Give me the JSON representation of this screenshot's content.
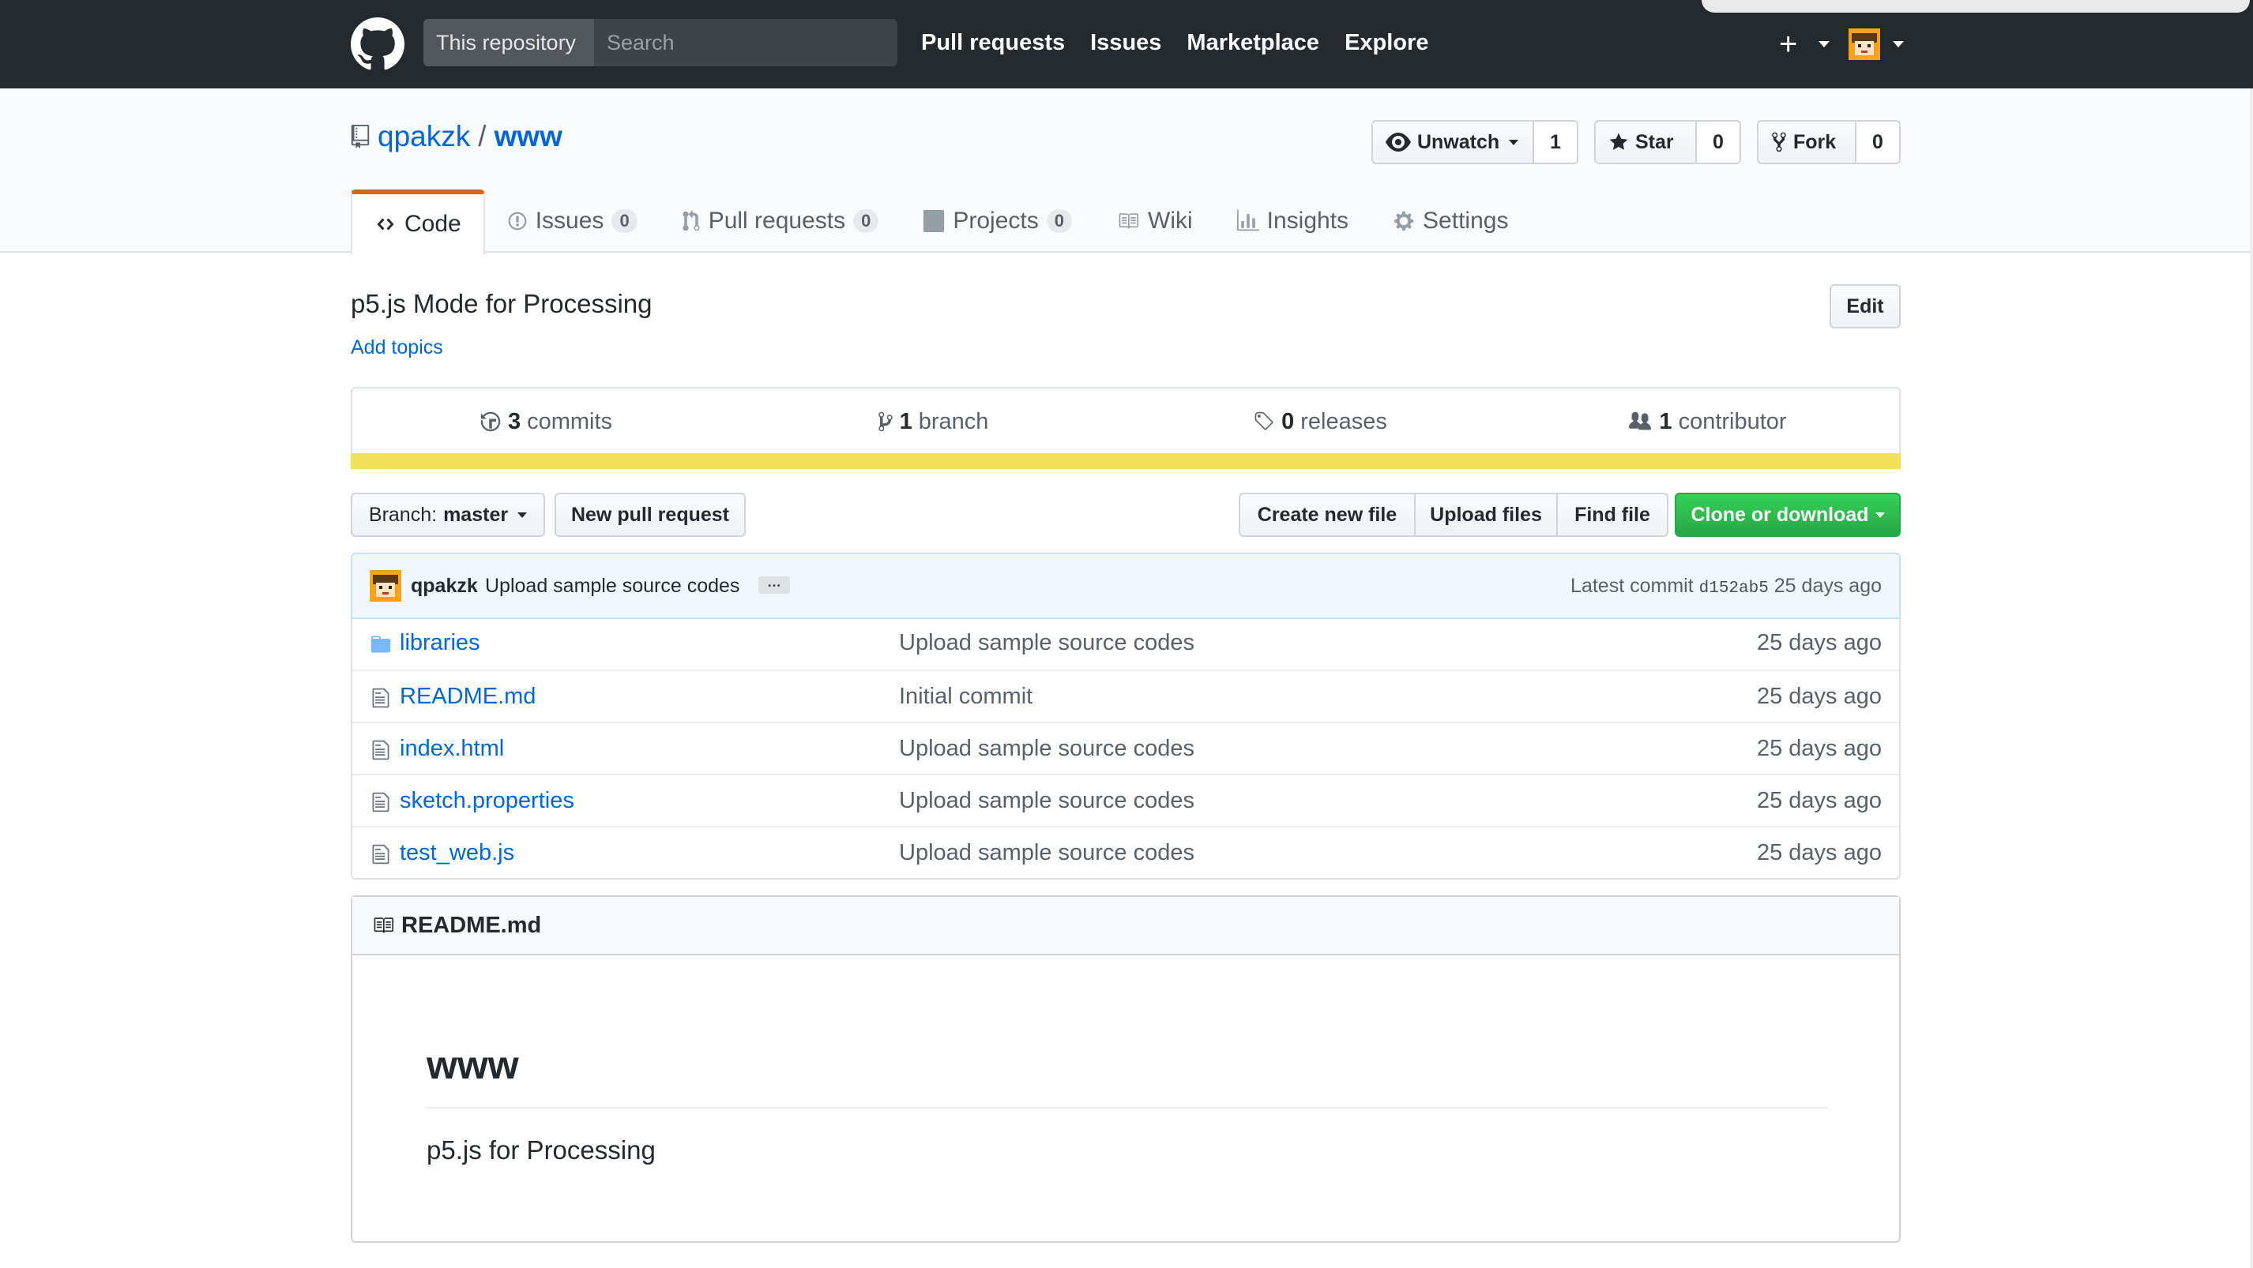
{
  "header": {
    "search_scope": "This repository",
    "search_placeholder": "Search",
    "nav": [
      "Pull requests",
      "Issues",
      "Marketplace",
      "Explore"
    ],
    "plus": "+"
  },
  "repo": {
    "owner": "qpakzk",
    "separator": "/",
    "name": "www",
    "actions": {
      "watch_label": "Unwatch",
      "watch_count": "1",
      "star_label": "Star",
      "star_count": "0",
      "fork_label": "Fork",
      "fork_count": "0"
    },
    "tabs": [
      {
        "label": "Code",
        "counter": ""
      },
      {
        "label": "Issues",
        "counter": "0"
      },
      {
        "label": "Pull requests",
        "counter": "0"
      },
      {
        "label": "Projects",
        "counter": "0"
      },
      {
        "label": "Wiki",
        "counter": ""
      },
      {
        "label": "Insights",
        "counter": ""
      },
      {
        "label": "Settings",
        "counter": ""
      }
    ],
    "description": "p5.js Mode for Processing",
    "add_topics": "Add topics",
    "edit_label": "Edit"
  },
  "summary": {
    "commits_num": "3",
    "commits_label": "commits",
    "branch_num": "1",
    "branch_label": "branch",
    "releases_num": "0",
    "releases_label": "releases",
    "contributor_num": "1",
    "contributor_label": "contributor",
    "language_color": "#f1e05a"
  },
  "file_nav": {
    "branch_prefix": "Branch:",
    "branch_name": "master",
    "new_pr": "New pull request",
    "create_file": "Create new file",
    "upload_files": "Upload files",
    "find_file": "Find file",
    "clone": "Clone or download"
  },
  "commit": {
    "author": "qpakzk",
    "message": "Upload sample source codes",
    "ellipsis": "…",
    "latest_label": "Latest commit",
    "sha": "d152ab5",
    "age": "25 days ago"
  },
  "files": [
    {
      "name": "libraries",
      "type": "folder",
      "message": "Upload sample source codes",
      "age": "25 days ago"
    },
    {
      "name": "README.md",
      "type": "file",
      "message": "Initial commit",
      "age": "25 days ago"
    },
    {
      "name": "index.html",
      "type": "file",
      "message": "Upload sample source codes",
      "age": "25 days ago"
    },
    {
      "name": "sketch.properties",
      "type": "file",
      "message": "Upload sample source codes",
      "age": "25 days ago"
    },
    {
      "name": "test_web.js",
      "type": "file",
      "message": "Upload sample source codes",
      "age": "25 days ago"
    }
  ],
  "readme": {
    "title": "README.md",
    "h1": "www",
    "body": "p5.js for Processing"
  },
  "colors": {
    "header_bg": "#24292e",
    "link": "#0366d6",
    "green": "#28a745",
    "tab_accent": "#e36209"
  }
}
